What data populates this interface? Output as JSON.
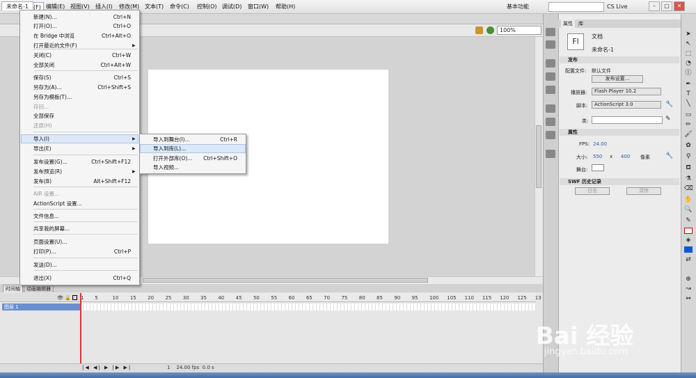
{
  "app": {
    "logo": "Fl"
  },
  "menubar": {
    "items": [
      "文件(F)",
      "编辑(E)",
      "视图(V)",
      "插入(I)",
      "修改(M)",
      "文本(T)",
      "命令(C)",
      "控制(O)",
      "调试(D)",
      "窗口(W)",
      "帮助(H)"
    ],
    "workspace": "基本功能",
    "cs_live": "CS Live"
  },
  "document": {
    "tab": "未命名-1",
    "zoom": "100%"
  },
  "file_menu": {
    "items": [
      {
        "label": "新建(N)...",
        "shortcut": "Ctrl+N"
      },
      {
        "label": "打开(O)...",
        "shortcut": "Ctrl+O"
      },
      {
        "label": "在 Bridge 中浏览",
        "shortcut": "Ctrl+Alt+O"
      },
      {
        "label": "打开最近的文件(F)",
        "shortcut": ""
      },
      {
        "label": "关闭(C)",
        "shortcut": "Ctrl+W"
      },
      {
        "label": "全部关闭",
        "shortcut": "Ctrl+Alt+W"
      },
      {
        "label": "保存(S)",
        "shortcut": "Ctrl+S"
      },
      {
        "label": "另存为(A)...",
        "shortcut": "Ctrl+Shift+S"
      },
      {
        "label": "另存为模板(T)...",
        "shortcut": ""
      },
      {
        "label": "存回...",
        "shortcut": ""
      },
      {
        "label": "全部保存",
        "shortcut": ""
      },
      {
        "label": "还原(H)",
        "shortcut": ""
      },
      {
        "label": "导入(I)",
        "shortcut": ""
      },
      {
        "label": "导出(E)",
        "shortcut": ""
      },
      {
        "label": "发布设置(G)...",
        "shortcut": "Ctrl+Shift+F12"
      },
      {
        "label": "发布预览(R)",
        "shortcut": ""
      },
      {
        "label": "发布(B)",
        "shortcut": "Alt+Shift+F12"
      },
      {
        "label": "AIR 设置...",
        "shortcut": ""
      },
      {
        "label": "ActionScript 设置...",
        "shortcut": ""
      },
      {
        "label": "文件信息...",
        "shortcut": ""
      },
      {
        "label": "共享我的屏幕...",
        "shortcut": ""
      },
      {
        "label": "页面设置(U)...",
        "shortcut": ""
      },
      {
        "label": "打印(P)...",
        "shortcut": "Ctrl+P"
      },
      {
        "label": "发送(D)...",
        "shortcut": ""
      },
      {
        "label": "退出(X)",
        "shortcut": "Ctrl+Q"
      }
    ]
  },
  "import_submenu": {
    "items": [
      {
        "label": "导入到舞台(I)...",
        "shortcut": "Ctrl+R"
      },
      {
        "label": "导入到库(L)...",
        "shortcut": ""
      },
      {
        "label": "打开外部库(O)...",
        "shortcut": "Ctrl+Shift+O"
      },
      {
        "label": "导入视频...",
        "shortcut": ""
      }
    ]
  },
  "timeline": {
    "tabs": [
      "时间轴",
      "动画编辑器"
    ],
    "layer": "图层 1",
    "frame_ticks": [
      "1",
      "5",
      "10",
      "15",
      "20",
      "25",
      "30",
      "35",
      "40",
      "45",
      "50",
      "55",
      "60",
      "65",
      "70",
      "75",
      "80",
      "85",
      "90",
      "95",
      "100",
      "105",
      "110",
      "115",
      "120",
      "125",
      "13"
    ],
    "status": {
      "frame": "1",
      "fps": "24.00",
      "fps_unit": "fps",
      "time": "0.0 s"
    }
  },
  "properties": {
    "tabs": [
      "属性",
      "库"
    ],
    "doc_type": "文档",
    "doc_name": "未命名-1",
    "doc_icon": "Fl",
    "publish_section": "发布",
    "profile_label": "配置文件:",
    "profile_value": "默认文件",
    "publish_settings_btn": "发布设置...",
    "player_label": "播放器:",
    "player_value": "Flash Player 10.2",
    "script_label": "脚本:",
    "script_value": "ActionScript 3.0",
    "class_label": "类:",
    "props_section": "属性",
    "fps_label": "FPS:",
    "fps_value": "24.00",
    "size_label": "大小:",
    "width": "550",
    "x": "x",
    "height": "400",
    "unit": "像素",
    "stage_label": "舞台:",
    "history_section": "SWF 历史记录",
    "log_btn": "日志",
    "clear_btn": "清除"
  },
  "watermark": {
    "text": "Bai 经验",
    "url": "jingyan.baidu.com"
  }
}
